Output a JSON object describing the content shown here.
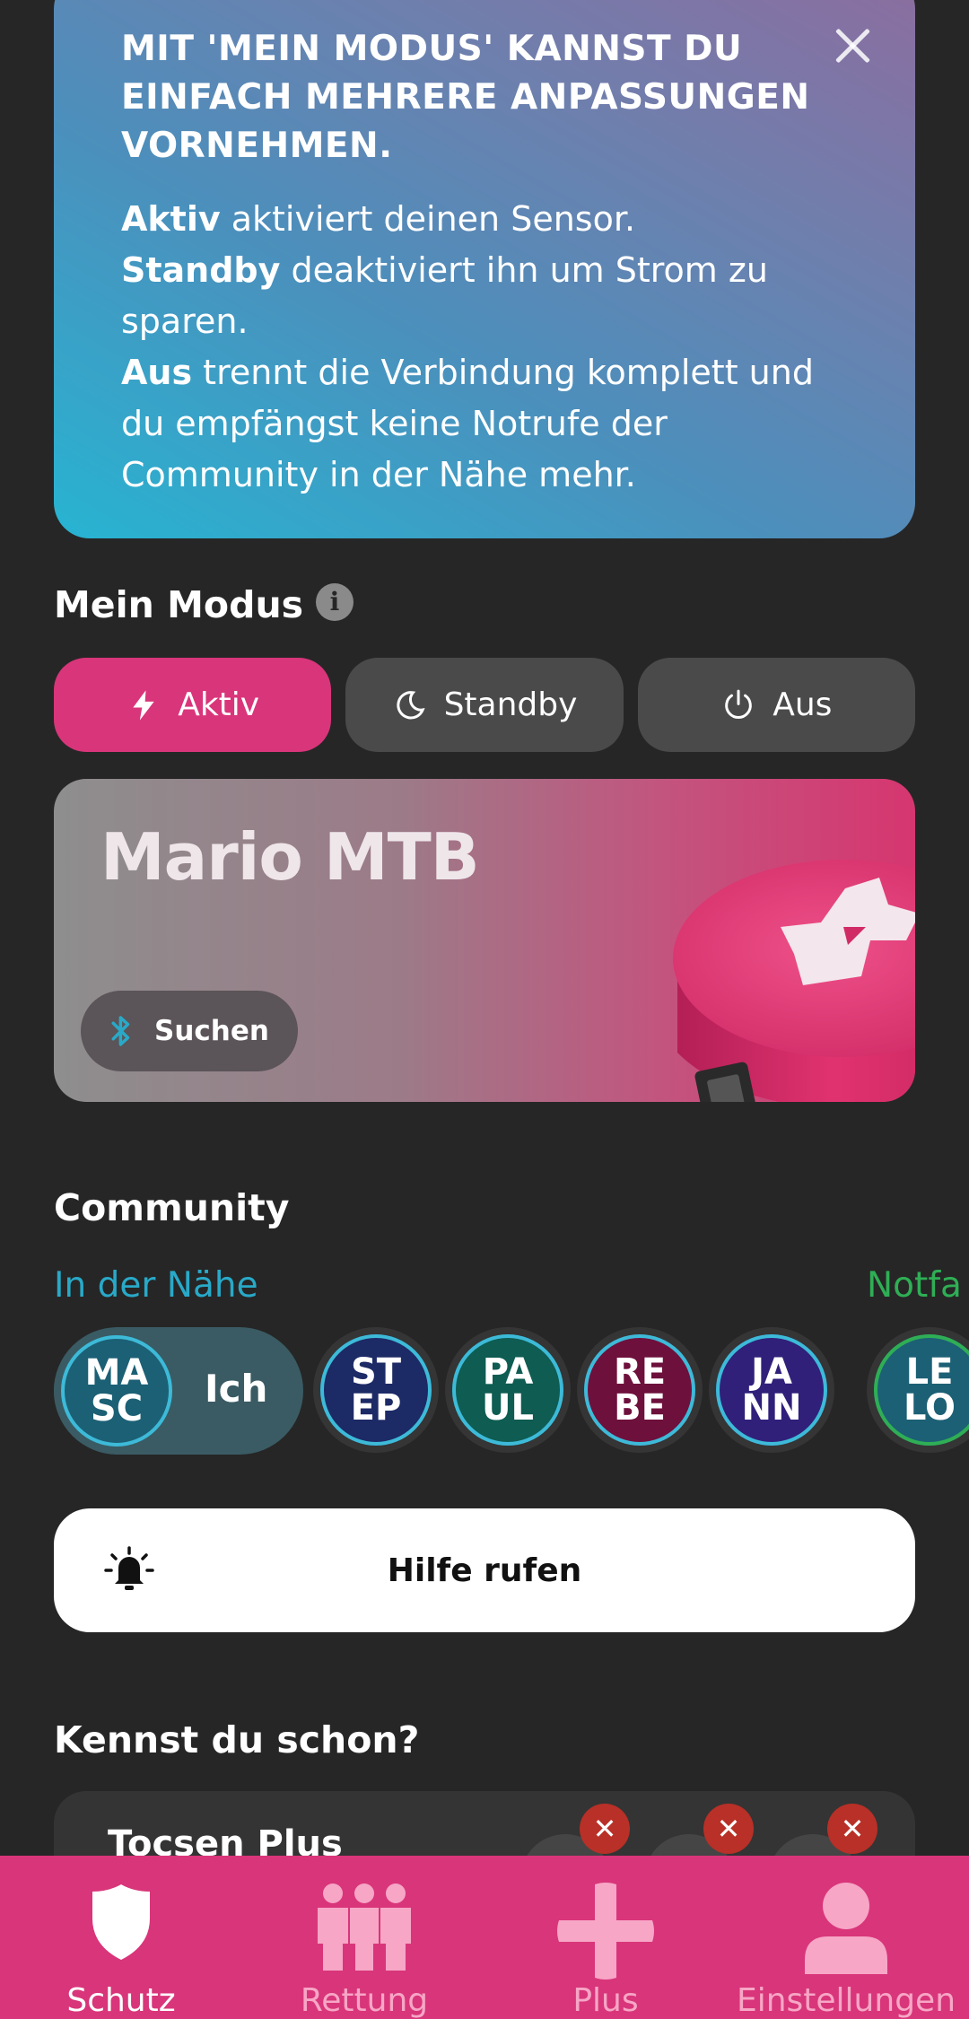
{
  "banner": {
    "title": "MIT 'MEIN MODUS' KANNST DU EINFACH MEHRERE ANPASSUNGEN VORNEHMEN.",
    "lines": [
      {
        "bold": "Aktiv",
        "text": " aktiviert deinen Sensor."
      },
      {
        "bold": "Standby",
        "text": " deaktiviert ihn um Strom zu sparen."
      },
      {
        "bold": "Aus",
        "text": " trennt die Verbindung komplett und du empfängst keine Notrufe der Community in der Nähe mehr."
      }
    ]
  },
  "mode": {
    "title": "Mein Modus",
    "info_icon": "info-icon",
    "options": [
      {
        "label": "Aktiv",
        "icon": "lightning-icon",
        "active": true
      },
      {
        "label": "Standby",
        "icon": "moon-icon",
        "active": false
      },
      {
        "label": "Aus",
        "icon": "power-icon",
        "active": false
      }
    ]
  },
  "sensor": {
    "name": "Mario MTB",
    "search_label": "Suchen",
    "search_icon": "bluetooth-icon"
  },
  "community": {
    "title": "Community",
    "tab_nearby": "In der Nähe",
    "tab_emergency": "Notfa",
    "me": {
      "initials": [
        "MA",
        "SC"
      ],
      "label": "Ich",
      "color": "#1c6075"
    },
    "members": [
      {
        "initials": [
          "ST",
          "EP"
        ],
        "color": "#1c2a66"
      },
      {
        "initials": [
          "PA",
          "UL"
        ],
        "color": "#0e5c52"
      },
      {
        "initials": [
          "RE",
          "BE"
        ],
        "color": "#6e103c"
      },
      {
        "initials": [
          "JA",
          "NN"
        ],
        "color": "#30207a"
      }
    ],
    "emergency_member": {
      "initials": [
        "LE",
        "LO"
      ],
      "color": "#1c6075"
    }
  },
  "help": {
    "label": "Hilfe rufen",
    "icon": "alarm-bell-icon"
  },
  "promo": {
    "title": "Kennst du schon?",
    "card_title": "Tocsen Plus",
    "dismiss_glyph": "✕"
  },
  "nav": {
    "items": [
      {
        "label": "Schutz",
        "icon": "shield-icon",
        "active": true
      },
      {
        "label": "Rettung",
        "icon": "group-icon",
        "active": false
      },
      {
        "label": "Plus",
        "icon": "plus-icon",
        "active": false
      },
      {
        "label": "Einstellungen",
        "icon": "profile-icon",
        "active": false
      }
    ]
  },
  "colors": {
    "accent": "#d9357a",
    "teal": "#29a9c8",
    "emergency_green": "#2fae55",
    "background": "#262626"
  }
}
